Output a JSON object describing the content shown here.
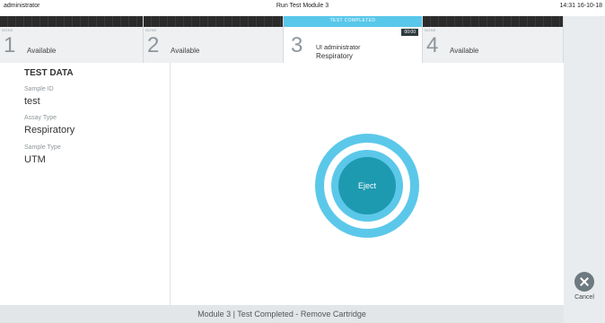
{
  "header": {
    "user": "administrator",
    "title": "Run Test Module 3",
    "clock": "14:31 16-10-18"
  },
  "modules": [
    {
      "number": "1",
      "label": "Available",
      "mini": "NONE"
    },
    {
      "number": "2",
      "label": "Available",
      "mini": "NONE"
    },
    {
      "number": "3",
      "status": "TEST COMPLETED",
      "timer": "00:00",
      "line1": "UI administrator",
      "line2": "Respiratory"
    },
    {
      "number": "4",
      "label": "Available",
      "mini": "NONE"
    }
  ],
  "test_data": {
    "heading": "TEST DATA",
    "sample_id_label": "Sample ID",
    "sample_id": "test",
    "assay_type_label": "Assay Type",
    "assay_type": "Respiratory",
    "sample_type_label": "Sample Type",
    "sample_type": "UTM"
  },
  "main": {
    "eject_label": "Eject"
  },
  "sidebar": {
    "cancel_label": "Cancel"
  },
  "status_bar": "Module 3  |  Test Completed - Remove Cartridge",
  "colors": {
    "accent": "#5bc8ea",
    "eject": "#1e9ab0",
    "panel": "#e9ecee"
  }
}
